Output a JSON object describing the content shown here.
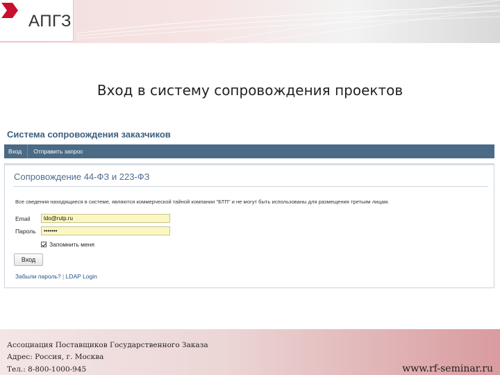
{
  "brand": {
    "logo_text": "АПГЗ",
    "logo_icon": "apgz-logo-mark",
    "accent_color": "#c8102e"
  },
  "slide": {
    "title": "Вход в систему сопровождения проектов"
  },
  "app": {
    "title": "Система сопровождения заказчиков",
    "nav": {
      "items": [
        {
          "label": "Вход"
        },
        {
          "label": "Отправить запрос"
        }
      ]
    },
    "panel": {
      "heading": "Сопровождение 44-ФЗ и 223-ФЗ",
      "notice": "Все сведения находящиеся в системе, являются коммерческой тайной компании \"БТП\" и не могут быть использованы для размещения третьим лицам.",
      "email_label": "Email",
      "email_value": "ldo@rutp.ru",
      "password_label": "Пароль",
      "password_value": "•••••••",
      "remember_label": "Запомнить меня",
      "remember_checked": true,
      "login_button": "Вход",
      "forgot_link": "Забыли пароль?",
      "link_separator": "|",
      "ldap_link": "LDAP Login"
    },
    "colors": {
      "navbar": "#4b6a86",
      "heading": "#4e6e8f",
      "input_bg": "#fbf7c2",
      "link": "#1f4f8c"
    }
  },
  "footer": {
    "line1": "Ассоциация Поставщиков Государственного Заказа",
    "line2": "Адрес: Россия, г. Москва",
    "line3": "Тел.: 8-800-1000-945",
    "site": "www.rf-seminar.ru"
  }
}
